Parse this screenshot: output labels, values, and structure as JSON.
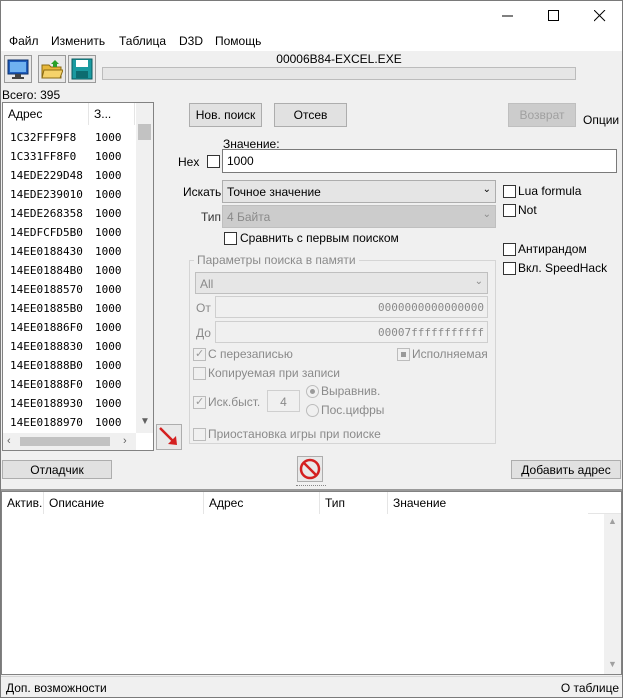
{
  "menu": [
    "Файл",
    "Изменить",
    "Таблица",
    "D3D",
    "Помощь"
  ],
  "process_title": "00006B84-EXCEL.EXE",
  "found_count": "Всего: 395",
  "address_list": {
    "headers": [
      "Адрес",
      "З..."
    ],
    "rows": [
      {
        "address": "1C32FFF9F8",
        "value": "1000"
      },
      {
        "address": "1C331FF8F0",
        "value": "1000"
      },
      {
        "address": "14EDE229D48",
        "value": "1000"
      },
      {
        "address": "14EDE239010",
        "value": "1000"
      },
      {
        "address": "14EDE268358",
        "value": "1000"
      },
      {
        "address": "14EDFCFD5B0",
        "value": "1000"
      },
      {
        "address": "14EE0188430",
        "value": "1000"
      },
      {
        "address": "14EE01884B0",
        "value": "1000"
      },
      {
        "address": "14EE0188570",
        "value": "1000"
      },
      {
        "address": "14EE01885B0",
        "value": "1000"
      },
      {
        "address": "14EE01886F0",
        "value": "1000"
      },
      {
        "address": "14EE0188830",
        "value": "1000"
      },
      {
        "address": "14EE01888B0",
        "value": "1000"
      },
      {
        "address": "14EE01888F0",
        "value": "1000"
      },
      {
        "address": "14EE0188930",
        "value": "1000"
      },
      {
        "address": "14EE0188970",
        "value": "1000"
      }
    ]
  },
  "buttons": {
    "new_scan": "Нов. поиск",
    "next_scan": "Отсев",
    "undo_scan": "Возврат",
    "options": "Опции",
    "debugger": "Отладчик",
    "add_address": "Добавить адрес"
  },
  "value_section": {
    "label": "Значение:",
    "hex_label": "Hex",
    "value": "1000"
  },
  "scan_type": {
    "label": "Искать",
    "selected": "Точное значение"
  },
  "value_type": {
    "label": "Тип",
    "selected": "4 Байта"
  },
  "compare_first": "Сравнить с первым поиском",
  "right_options": {
    "lua_formula": "Lua formula",
    "not": "Not",
    "unrandomizer": "Антирандом",
    "speedhack": "Вкл. SpeedHack"
  },
  "memory_options": {
    "title": "Параметры поиска в памяти",
    "region": "All",
    "from_label": "От",
    "from_value": "0000000000000000",
    "to_label": "До",
    "to_value": "00007fffffffffff",
    "writable": "С перезаписью",
    "executable": "Исполняемая",
    "copy_on_write": "Копируемая при записи",
    "fast_scan": "Иск.быст.",
    "fast_scan_value": "4",
    "alignment": "Выравнив.",
    "last_digits": "Пос.цифры",
    "pause_game": "Приостановка игры при поиске"
  },
  "cheat_table": {
    "headers": [
      "Актив.",
      "Описание",
      "Адрес",
      "Тип",
      "Значение"
    ]
  },
  "status": {
    "left": "Доп. возможности",
    "right": "О таблице"
  },
  "colors": {
    "window_bg": "#f0f0f0",
    "disabled_text": "#8a8a8a",
    "arrow_red": "#d42020"
  }
}
